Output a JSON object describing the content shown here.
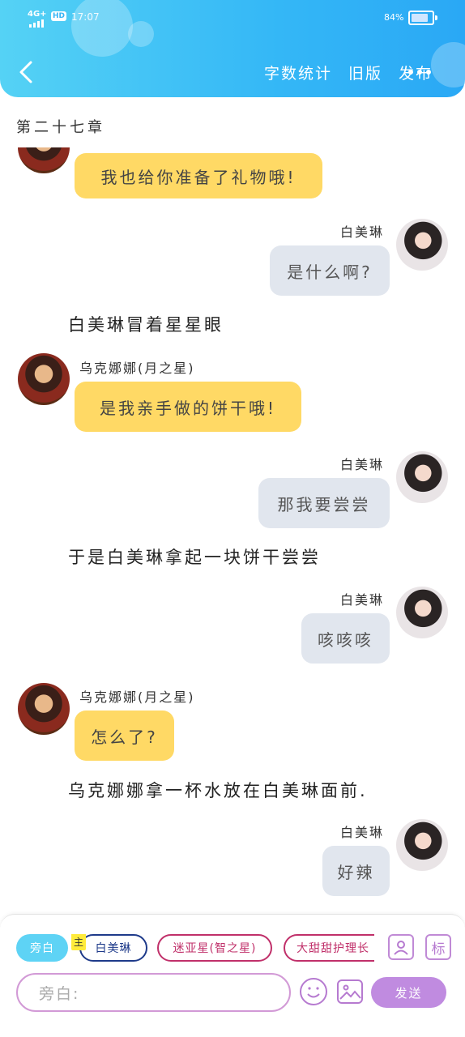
{
  "status_bar": {
    "network": "4G+",
    "hd": "HD",
    "time": "17:07",
    "battery": "84%",
    "battery_level": 0.84
  },
  "header": {
    "actions": [
      "字数统计",
      "旧版",
      "发布"
    ],
    "colors": {
      "gradient_start": "#55d2f5",
      "gradient_end": "#2aa8f5"
    }
  },
  "chapter_title": "第二十七章",
  "messages": [
    {
      "type": "left",
      "speaker": "",
      "text": "我也给你准备了礼物哦!"
    },
    {
      "type": "right",
      "speaker": "白美琳",
      "text": "是什么啊?"
    },
    {
      "type": "narration",
      "text": "白美琳冒着星星眼"
    },
    {
      "type": "left",
      "speaker": "乌克娜娜(月之星)",
      "text": "是我亲手做的饼干哦!"
    },
    {
      "type": "right",
      "speaker": "白美琳",
      "text": "那我要尝尝"
    },
    {
      "type": "narration",
      "text": "于是白美琳拿起一块饼干尝尝"
    },
    {
      "type": "right",
      "speaker": "白美琳",
      "text": "咳咳咳"
    },
    {
      "type": "left",
      "speaker": "乌克娜娜(月之星)",
      "text": "怎么了?"
    },
    {
      "type": "narration",
      "text": "乌克娜娜拿一杯水放在白美琳面前."
    },
    {
      "type": "right",
      "speaker": "白美琳",
      "text": "好辣"
    }
  ],
  "role_chips": {
    "aside": "旁白",
    "main_tag": "主",
    "bai": "白美琳",
    "mi": "迷亚星(智之星)",
    "da": "大甜甜护理长"
  },
  "icon_labels": {
    "mark": "标"
  },
  "input": {
    "placeholder": "旁白:"
  },
  "send_label": "发送"
}
